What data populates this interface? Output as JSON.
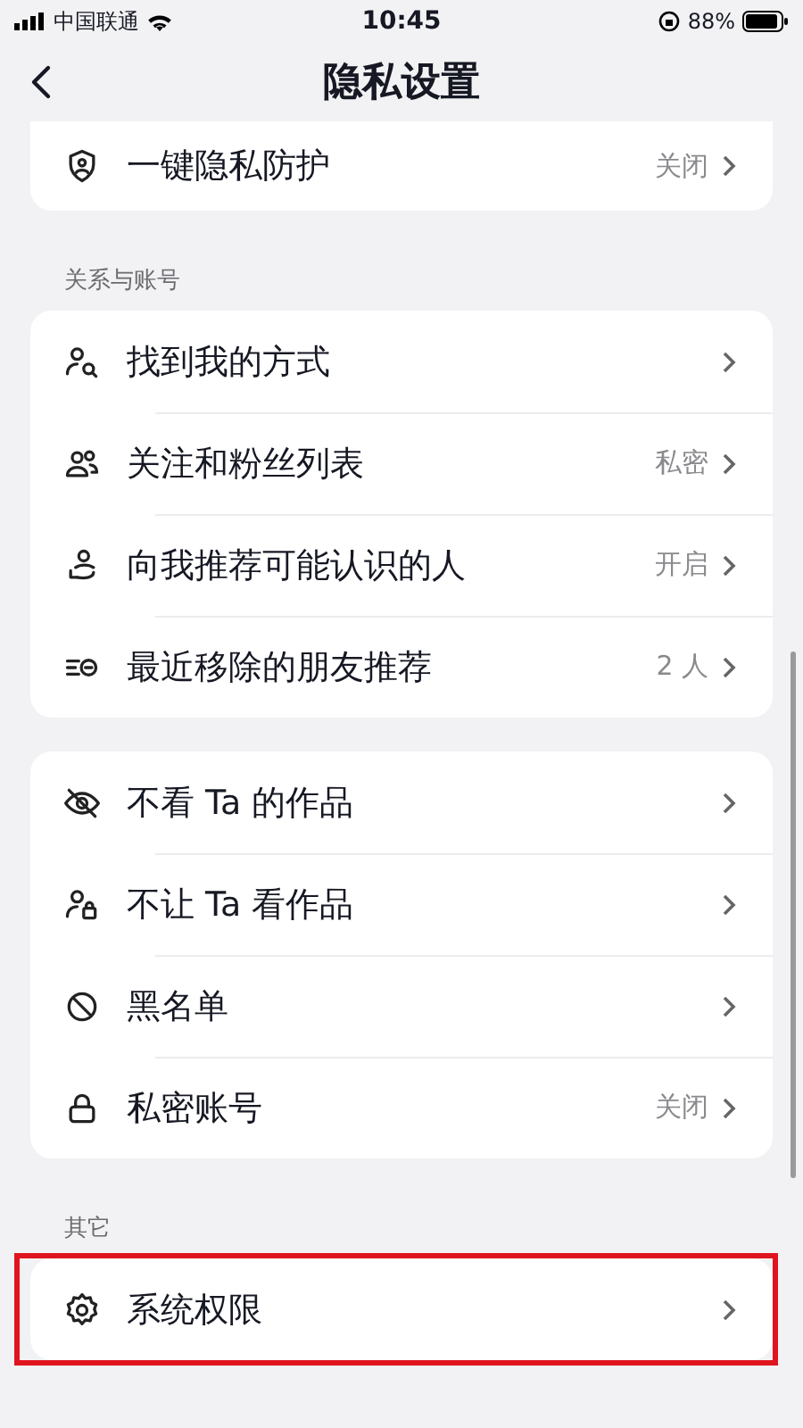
{
  "status_bar": {
    "carrier": "中国联通",
    "time": "10:45",
    "battery": "88%"
  },
  "nav": {
    "title": "隐私设置"
  },
  "sections": [
    {
      "items": [
        {
          "label": "一键隐私防护",
          "value": "关闭",
          "highlighted": false
        }
      ]
    },
    {
      "header": "关系与账号",
      "items": [
        {
          "label": "找到我的方式",
          "highlighted": false
        },
        {
          "label": "关注和粉丝列表",
          "value": "私密",
          "highlighted": false
        },
        {
          "label": "向我推荐可能认识的人",
          "value": "开启",
          "highlighted": false
        },
        {
          "label": "最近移除的朋友推荐",
          "value": "2 人",
          "highlighted": false
        }
      ]
    },
    {
      "items": [
        {
          "label": "不看 Ta 的作品",
          "highlighted": false
        },
        {
          "label": "不让 Ta 看作品",
          "highlighted": false
        },
        {
          "label": "黑名单",
          "highlighted": false
        },
        {
          "label": "私密账号",
          "value": "关闭",
          "highlighted": false
        }
      ]
    },
    {
      "header": "其它",
      "items": [
        {
          "label": "系统权限",
          "highlighted": true
        }
      ]
    }
  ]
}
